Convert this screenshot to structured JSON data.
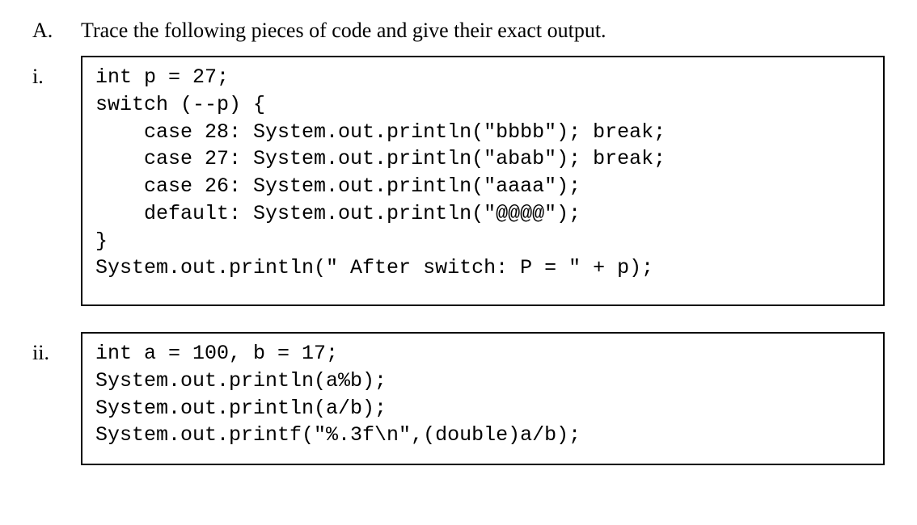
{
  "question": {
    "letter": "A.",
    "prompt": "Trace the following pieces of code and give their exact output."
  },
  "parts": [
    {
      "roman": "i.",
      "code": "int p = 27;\nswitch (--p) {\n    case 28: System.out.println(\"bbbb\"); break;\n    case 27: System.out.println(\"abab\"); break;\n    case 26: System.out.println(\"aaaa\");\n    default: System.out.println(\"@@@@\");\n}\nSystem.out.println(\" After switch: P = \" + p);"
    },
    {
      "roman": "ii.",
      "code": "int a = 100, b = 17;\nSystem.out.println(a%b);\nSystem.out.println(a/b);\nSystem.out.printf(\"%.3f\\n\",(double)a/b);"
    }
  ]
}
